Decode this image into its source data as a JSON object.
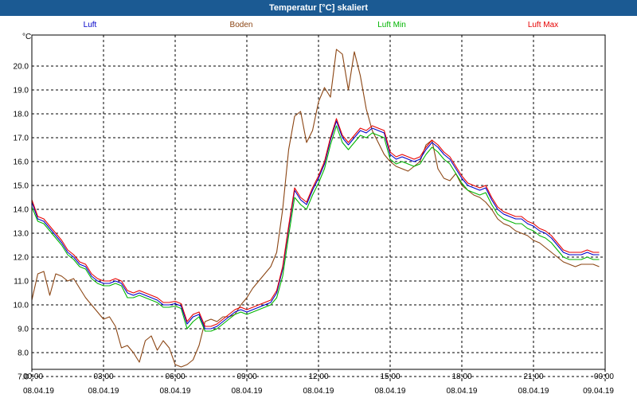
{
  "window": {
    "title": "Temperatur [°C] skaliert"
  },
  "chart_data": {
    "type": "line",
    "title": "Temperatur [°C] skaliert",
    "ylabel": "°C",
    "ylim": [
      6.8,
      21.3
    ],
    "y_ticks": [
      "7.0",
      "8.0",
      "9.0",
      "10.0",
      "11.0",
      "12.0",
      "13.0",
      "14.0",
      "15.0",
      "16.0",
      "17.0",
      "18.0",
      "19.0",
      "20.0"
    ],
    "x_range_hours": [
      0,
      24
    ],
    "x_ticks": [
      {
        "time": "00:00",
        "date": "08.04.19"
      },
      {
        "time": "03:00",
        "date": "08.04.19"
      },
      {
        "time": "06:00",
        "date": "08.04.19"
      },
      {
        "time": "09:00",
        "date": "08.04.19"
      },
      {
        "time": "12:00",
        "date": "08.04.19"
      },
      {
        "time": "15:00",
        "date": "08.04.19"
      },
      {
        "time": "18:00",
        "date": "08.04.19"
      },
      {
        "time": "21:00",
        "date": "08.04.19"
      },
      {
        "time": "00:00",
        "date": "09.04.19"
      }
    ],
    "grid": true,
    "legend_position": "top",
    "series": [
      {
        "name": "Luft",
        "color": "#0000c8",
        "x": [
          0,
          0.25,
          0.5,
          0.75,
          1,
          1.25,
          1.5,
          1.75,
          2,
          2.25,
          2.5,
          2.75,
          3,
          3.25,
          3.5,
          3.75,
          4,
          4.25,
          4.5,
          4.75,
          5,
          5.25,
          5.5,
          5.75,
          6,
          6.25,
          6.5,
          6.75,
          7,
          7.25,
          7.5,
          7.75,
          8,
          8.25,
          8.5,
          8.75,
          9,
          9.25,
          9.5,
          9.75,
          10,
          10.25,
          10.5,
          10.75,
          11,
          11.25,
          11.5,
          11.75,
          12,
          12.25,
          12.5,
          12.75,
          13,
          13.25,
          13.5,
          13.75,
          14,
          14.25,
          14.5,
          14.75,
          15,
          15.25,
          15.5,
          15.75,
          16,
          16.25,
          16.5,
          16.75,
          17,
          17.25,
          17.5,
          17.75,
          18,
          18.25,
          18.5,
          18.75,
          19,
          19.25,
          19.5,
          19.75,
          20,
          20.25,
          20.5,
          20.75,
          21,
          21.25,
          21.5,
          21.75,
          22,
          22.25,
          22.5,
          22.75,
          23,
          23.25,
          23.5,
          23.75
        ],
        "y": [
          14.3,
          13.6,
          13.5,
          13.2,
          12.9,
          12.6,
          12.2,
          12.0,
          11.7,
          11.6,
          11.2,
          11.0,
          10.9,
          10.9,
          11.0,
          10.9,
          10.5,
          10.4,
          10.5,
          10.4,
          10.3,
          10.2,
          10.0,
          10.0,
          10.05,
          9.95,
          9.2,
          9.5,
          9.6,
          9.0,
          9.0,
          9.1,
          9.3,
          9.5,
          9.7,
          9.8,
          9.7,
          9.8,
          9.9,
          10.0,
          10.1,
          10.5,
          11.5,
          13.2,
          14.8,
          14.4,
          14.2,
          14.8,
          15.3,
          15.9,
          16.9,
          17.7,
          17.0,
          16.7,
          17.0,
          17.3,
          17.2,
          17.4,
          17.3,
          17.2,
          16.3,
          16.1,
          16.2,
          16.1,
          16.0,
          16.1,
          16.5,
          16.8,
          16.6,
          16.3,
          16.1,
          15.7,
          15.3,
          15.0,
          14.9,
          14.8,
          14.9,
          14.4,
          14.0,
          13.8,
          13.7,
          13.6,
          13.6,
          13.4,
          13.3,
          13.1,
          13.0,
          12.8,
          12.5,
          12.2,
          12.1,
          12.1,
          12.1,
          12.2,
          12.1,
          12.1
        ]
      },
      {
        "name": "Boden",
        "color": "#8b4513",
        "x": [
          0,
          0.25,
          0.5,
          0.75,
          1,
          1.25,
          1.5,
          1.75,
          2,
          2.25,
          2.5,
          2.75,
          3,
          3.25,
          3.5,
          3.75,
          4,
          4.25,
          4.5,
          4.75,
          5,
          5.25,
          5.5,
          5.75,
          6,
          6.25,
          6.5,
          6.75,
          7,
          7.25,
          7.5,
          7.75,
          8,
          8.25,
          8.5,
          8.75,
          9,
          9.25,
          9.5,
          9.75,
          10,
          10.25,
          10.5,
          10.75,
          11,
          11.25,
          11.5,
          11.75,
          12,
          12.25,
          12.5,
          12.75,
          13,
          13.25,
          13.5,
          13.75,
          14,
          14.25,
          14.5,
          14.75,
          15,
          15.25,
          15.5,
          15.75,
          16,
          16.25,
          16.5,
          16.75,
          17,
          17.25,
          17.5,
          17.75,
          18,
          18.25,
          18.5,
          18.75,
          19,
          19.25,
          19.5,
          19.75,
          20,
          20.25,
          20.5,
          20.75,
          21,
          21.25,
          21.5,
          21.75,
          22,
          22.25,
          22.5,
          22.75,
          23,
          23.25,
          23.5,
          23.75
        ],
        "y": [
          10.2,
          11.3,
          11.4,
          10.4,
          11.3,
          11.2,
          11.0,
          11.1,
          10.7,
          10.3,
          10.0,
          9.7,
          9.4,
          9.5,
          9.1,
          8.2,
          8.3,
          8.0,
          7.6,
          8.5,
          8.7,
          8.1,
          8.5,
          8.2,
          7.5,
          7.4,
          7.5,
          7.7,
          8.3,
          9.3,
          9.4,
          9.3,
          9.5,
          9.5,
          9.6,
          10.0,
          10.3,
          10.7,
          11.0,
          11.3,
          11.6,
          12.2,
          14.0,
          16.5,
          17.9,
          18.1,
          16.8,
          17.3,
          18.5,
          19.1,
          18.7,
          20.7,
          20.5,
          19.0,
          20.6,
          19.6,
          18.2,
          17.3,
          16.8,
          16.3,
          16.0,
          15.8,
          15.7,
          15.6,
          15.8,
          16.0,
          16.7,
          16.9,
          15.7,
          15.3,
          15.2,
          15.5,
          15.0,
          14.8,
          14.6,
          14.5,
          14.3,
          14.0,
          13.6,
          13.4,
          13.3,
          13.1,
          13.0,
          12.9,
          12.7,
          12.6,
          12.4,
          12.2,
          12.0,
          11.8,
          11.7,
          11.6,
          11.7,
          11.7,
          11.7,
          11.6
        ]
      },
      {
        "name": "Luft Min",
        "color": "#00b400",
        "x": [
          0,
          0.25,
          0.5,
          0.75,
          1,
          1.25,
          1.5,
          1.75,
          2,
          2.25,
          2.5,
          2.75,
          3,
          3.25,
          3.5,
          3.75,
          4,
          4.25,
          4.5,
          4.75,
          5,
          5.25,
          5.5,
          5.75,
          6,
          6.25,
          6.5,
          6.75,
          7,
          7.25,
          7.5,
          7.75,
          8,
          8.25,
          8.5,
          8.75,
          9,
          9.25,
          9.5,
          9.75,
          10,
          10.25,
          10.5,
          10.75,
          11,
          11.25,
          11.5,
          11.75,
          12,
          12.25,
          12.5,
          12.75,
          13,
          13.25,
          13.5,
          13.75,
          14,
          14.25,
          14.5,
          14.75,
          15,
          15.25,
          15.5,
          15.75,
          16,
          16.25,
          16.5,
          16.75,
          17,
          17.25,
          17.5,
          17.75,
          18,
          18.25,
          18.5,
          18.75,
          19,
          19.25,
          19.5,
          19.75,
          20,
          20.25,
          20.5,
          20.75,
          21,
          21.25,
          21.5,
          21.75,
          22,
          22.25,
          22.5,
          22.75,
          23,
          23.25,
          23.5,
          23.75
        ],
        "y": [
          14.1,
          13.5,
          13.4,
          13.1,
          12.8,
          12.5,
          12.1,
          11.9,
          11.6,
          11.5,
          11.1,
          10.9,
          10.8,
          10.8,
          10.9,
          10.8,
          10.3,
          10.3,
          10.4,
          10.3,
          10.2,
          10.1,
          9.9,
          9.9,
          9.95,
          9.85,
          9.0,
          9.3,
          9.5,
          8.9,
          8.9,
          9.0,
          9.2,
          9.4,
          9.6,
          9.7,
          9.6,
          9.7,
          9.8,
          9.9,
          10.0,
          10.3,
          11.2,
          12.9,
          14.5,
          14.2,
          14.0,
          14.6,
          15.1,
          15.7,
          16.7,
          17.5,
          16.8,
          16.5,
          16.8,
          17.1,
          17.0,
          17.2,
          17.1,
          17.0,
          16.1,
          15.9,
          16.0,
          15.9,
          15.8,
          15.9,
          16.3,
          16.6,
          16.4,
          16.1,
          15.9,
          15.5,
          15.1,
          14.8,
          14.7,
          14.6,
          14.7,
          14.2,
          13.8,
          13.6,
          13.5,
          13.4,
          13.4,
          13.2,
          13.1,
          12.9,
          12.8,
          12.6,
          12.3,
          12.0,
          11.9,
          11.9,
          11.9,
          12.0,
          11.9,
          11.9
        ]
      },
      {
        "name": "Luft Max",
        "color": "#e60000",
        "x": [
          0,
          0.25,
          0.5,
          0.75,
          1,
          1.25,
          1.5,
          1.75,
          2,
          2.25,
          2.5,
          2.75,
          3,
          3.25,
          3.5,
          3.75,
          4,
          4.25,
          4.5,
          4.75,
          5,
          5.25,
          5.5,
          5.75,
          6,
          6.25,
          6.5,
          6.75,
          7,
          7.25,
          7.5,
          7.75,
          8,
          8.25,
          8.5,
          8.75,
          9,
          9.25,
          9.5,
          9.75,
          10,
          10.25,
          10.5,
          10.75,
          11,
          11.25,
          11.5,
          11.75,
          12,
          12.25,
          12.5,
          12.75,
          13,
          13.25,
          13.5,
          13.75,
          14,
          14.25,
          14.5,
          14.75,
          15,
          15.25,
          15.5,
          15.75,
          16,
          16.25,
          16.5,
          16.75,
          17,
          17.25,
          17.5,
          17.75,
          18,
          18.25,
          18.5,
          18.75,
          19,
          19.25,
          19.5,
          19.75,
          20,
          20.25,
          20.5,
          20.75,
          21,
          21.25,
          21.5,
          21.75,
          22,
          22.25,
          22.5,
          22.75,
          23,
          23.25,
          23.5,
          23.75
        ],
        "y": [
          14.4,
          13.7,
          13.6,
          13.3,
          13.0,
          12.7,
          12.3,
          12.1,
          11.8,
          11.7,
          11.3,
          11.1,
          11.0,
          11.0,
          11.1,
          11.0,
          10.6,
          10.5,
          10.6,
          10.5,
          10.4,
          10.3,
          10.1,
          10.1,
          10.15,
          10.05,
          9.3,
          9.6,
          9.7,
          9.1,
          9.1,
          9.2,
          9.4,
          9.6,
          9.8,
          9.9,
          9.8,
          9.9,
          10.0,
          10.1,
          10.2,
          10.6,
          11.6,
          13.3,
          14.9,
          14.5,
          14.3,
          14.9,
          15.4,
          16.0,
          17.0,
          17.8,
          17.1,
          16.8,
          17.1,
          17.4,
          17.3,
          17.5,
          17.4,
          17.3,
          16.4,
          16.2,
          16.3,
          16.2,
          16.1,
          16.2,
          16.6,
          16.9,
          16.7,
          16.4,
          16.2,
          15.8,
          15.4,
          15.1,
          15.0,
          14.9,
          15.0,
          14.5,
          14.1,
          13.9,
          13.8,
          13.7,
          13.7,
          13.5,
          13.4,
          13.2,
          13.1,
          12.9,
          12.6,
          12.3,
          12.2,
          12.2,
          12.2,
          12.3,
          12.2,
          12.2
        ]
      }
    ]
  }
}
